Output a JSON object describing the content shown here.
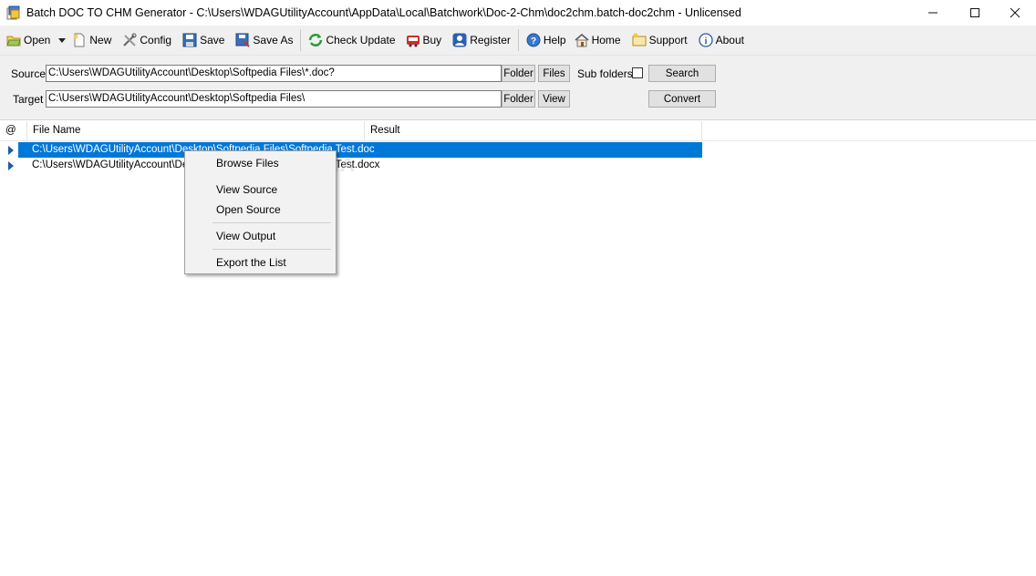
{
  "window": {
    "title": "Batch DOC TO CHM Generator - C:\\Users\\WDAGUtilityAccount\\AppData\\Local\\Batchwork\\Doc-2-Chm\\doc2chm.batch-doc2chm - Unlicensed",
    "controls": [
      "minimize-icon",
      "maximize-icon",
      "close-icon"
    ]
  },
  "toolbar": {
    "open": "Open",
    "new": "New",
    "config": "Config",
    "save": "Save",
    "save_as": "Save As",
    "check_update": "Check Update",
    "buy": "Buy",
    "register": "Register",
    "help": "Help",
    "home": "Home",
    "support": "Support",
    "about": "About"
  },
  "source": {
    "label": "Source",
    "value": "C:\\Users\\WDAGUtilityAccount\\Desktop\\Softpedia Files\\*.doc?",
    "folder_btn": "Folder",
    "files_btn": "Files",
    "subfolders_label": "Sub folders",
    "subfolders_checked": false,
    "search_btn": "Search"
  },
  "target": {
    "label": "Target",
    "value": "C:\\Users\\WDAGUtilityAccount\\Desktop\\Softpedia Files\\",
    "folder_btn": "Folder",
    "view_btn": "View",
    "convert_btn": "Convert"
  },
  "list": {
    "columns": [
      "@",
      "File Name",
      "Result"
    ],
    "rows": [
      {
        "file": "C:\\Users\\WDAGUtilityAccount\\Desktop\\Softpedia Files\\Softpedia Test.doc",
        "selected": true
      },
      {
        "file": "C:\\Users\\WDAGUtilityAccount\\Desktop\\Softpedia Files\\Softpedia Test.docx",
        "selected": false
      }
    ]
  },
  "context_menu": {
    "items": [
      "Browse Files",
      "View  Source",
      "Open Source",
      "View  Output",
      "Export the List"
    ]
  },
  "watermark": "SOFTPEDIA",
  "colors": {
    "selection": "#0078d7",
    "toolbar_bg": "#f0f0f0",
    "row_arrow": "#1f5aa6"
  }
}
